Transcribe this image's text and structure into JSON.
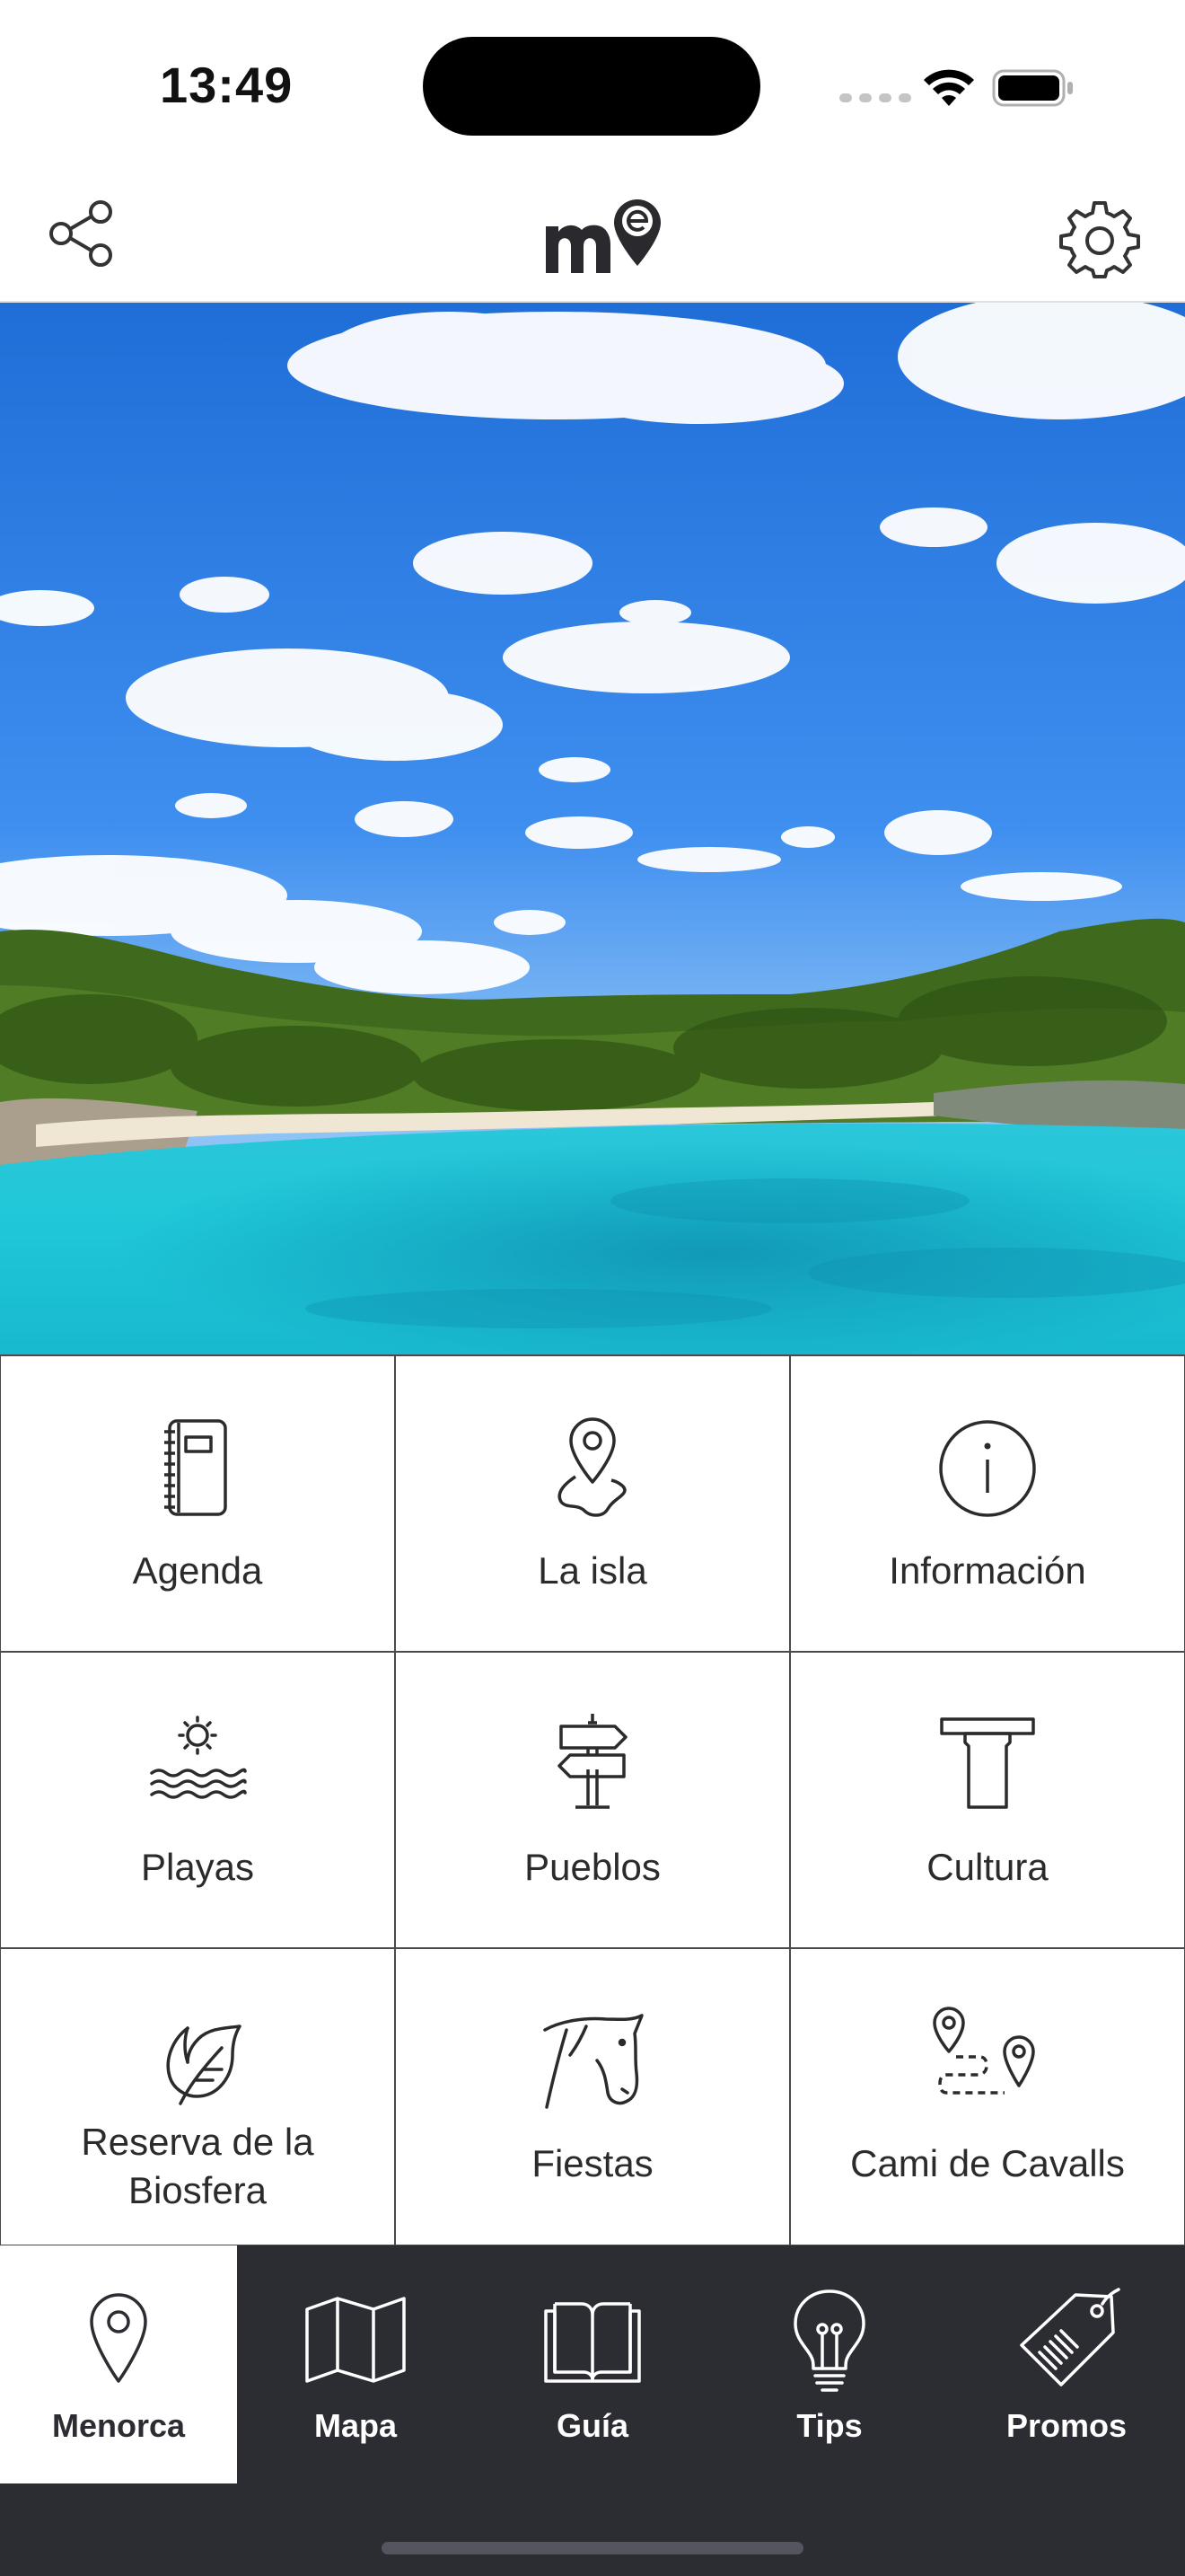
{
  "status_bar": {
    "time": "13:49"
  },
  "header": {
    "share_icon": "share-icon",
    "logo_icon": "menorca-logo",
    "settings_icon": "gear-icon"
  },
  "grid": {
    "items": [
      {
        "label": "Agenda",
        "icon": "notebook-icon"
      },
      {
        "label": "La isla",
        "icon": "map-pin-island-icon"
      },
      {
        "label": "Información",
        "icon": "info-icon"
      },
      {
        "label": "Playas",
        "icon": "beach-sun-waves-icon"
      },
      {
        "label": "Pueblos",
        "icon": "signpost-icon"
      },
      {
        "label": "Cultura",
        "icon": "taula-monument-icon"
      },
      {
        "label": "Reserva de la Biosfera",
        "icon": "leaf-icon"
      },
      {
        "label": "Fiestas",
        "icon": "horse-head-icon"
      },
      {
        "label": "Cami de Cavalls",
        "icon": "route-pins-icon"
      }
    ]
  },
  "tab_bar": {
    "tabs": [
      {
        "label": "Menorca",
        "icon": "map-pin-icon",
        "active": true
      },
      {
        "label": "Mapa",
        "icon": "folded-map-icon",
        "active": false
      },
      {
        "label": "Guía",
        "icon": "open-book-icon",
        "active": false
      },
      {
        "label": "Tips",
        "icon": "light-bulb-icon",
        "active": false
      },
      {
        "label": "Promos",
        "icon": "price-tag-icon",
        "active": false
      }
    ]
  },
  "colors": {
    "tab_bar_bg": "#2c2c33",
    "grid_border": "#4a4a4d",
    "text": "#2b2b2e"
  }
}
